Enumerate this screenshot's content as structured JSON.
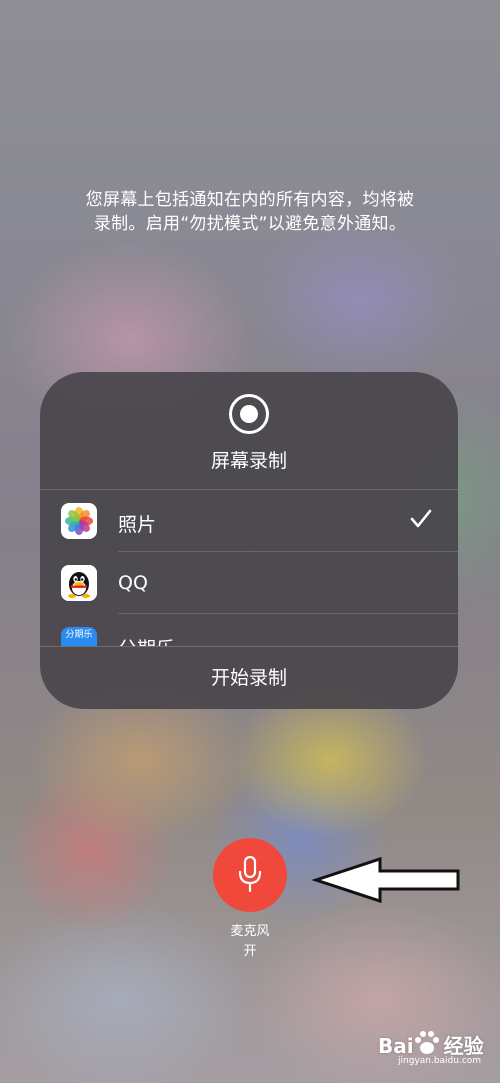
{
  "notice": {
    "line1": "您屏幕上包括通知在内的所有内容，均将被",
    "line2": "录制。启用“勿扰模式”以避免意外通知。"
  },
  "panel": {
    "title": "屏幕录制",
    "record_icon": "record-icon",
    "items": [
      {
        "label": "照片",
        "icon": "photos-icon",
        "selected": true
      },
      {
        "label": "QQ",
        "icon": "qq-icon",
        "selected": false
      },
      {
        "label": "分期乐",
        "icon": "fenqile-icon",
        "icon_text": "分期乐",
        "selected": false
      }
    ],
    "start_label": "开始录制"
  },
  "microphone": {
    "icon": "microphone-icon",
    "label_line1": "麦克风",
    "label_line2": "开",
    "color": "#f0493c"
  },
  "annotation": {
    "icon": "arrow-left-icon"
  },
  "watermark": {
    "brand_left": "Bai",
    "brand_right": "经验",
    "url": "jingyan.baidu.com"
  }
}
